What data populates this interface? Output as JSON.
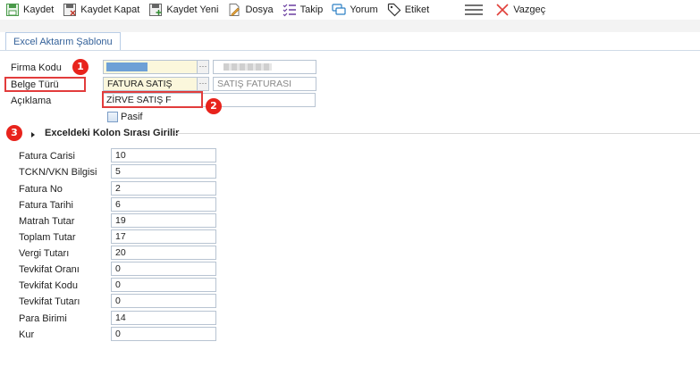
{
  "toolbar": {
    "kaydet": "Kaydet",
    "kaydet_kapat": "Kaydet Kapat",
    "kaydet_yeni": "Kaydet Yeni",
    "dosya": "Dosya",
    "takip": "Takip",
    "yorum": "Yorum",
    "etiket": "Etiket",
    "vazgec": "Vazgeç"
  },
  "tab": {
    "label": "Excel Aktarım Şablonu"
  },
  "form": {
    "firma_kodu_label": "Firma Kodu",
    "belge_turu_label": "Belge Türü",
    "belge_turu_value": "FATURA SATIŞ",
    "belge_turu_desc": "SATIŞ FATURASI",
    "aciklama_label": "Açıklama",
    "aciklama_value": "ZİRVE SATIŞ F",
    "pasif_label": "Pasif",
    "lookup_button": "···"
  },
  "badges": {
    "b1": "1",
    "b2": "2",
    "b3": "3"
  },
  "section": {
    "title": "Exceldeki Kolon Sırası Girilir"
  },
  "columns": [
    {
      "label": "Fatura Carisi",
      "value": "10"
    },
    {
      "label": "TCKN/VKN Bilgisi",
      "value": "5"
    },
    {
      "label": "Fatura No",
      "value": "2"
    },
    {
      "label": "Fatura Tarihi",
      "value": "6"
    },
    {
      "label": "Matrah Tutar",
      "value": "19"
    },
    {
      "label": "Toplam Tutar",
      "value": "17"
    },
    {
      "label": "Vergi Tutarı",
      "value": "20"
    },
    {
      "label": "Tevkifat Oranı",
      "value": "0"
    },
    {
      "label": "Tevkifat Kodu",
      "value": "0"
    },
    {
      "label": "Tevkifat Tutarı",
      "value": "0"
    },
    {
      "label": "Para Birimi",
      "value": "14"
    },
    {
      "label": "Kur",
      "value": "0"
    }
  ],
  "colors": {
    "badge": "#e8231c",
    "highlight_border": "#e23c3c",
    "tab_text": "#35629a",
    "lookup_bg": "#fbf7dc"
  }
}
